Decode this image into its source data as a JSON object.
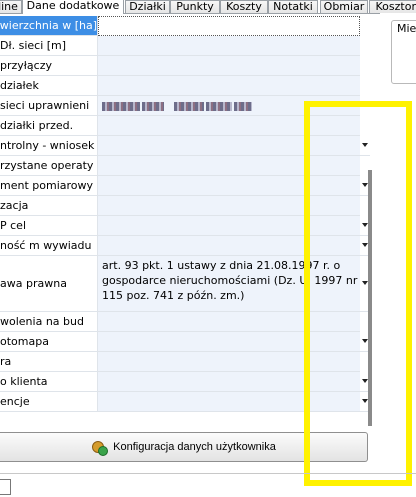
{
  "tabs": [
    {
      "label": "line"
    },
    {
      "label": "Dane dodatkowe",
      "active": true
    },
    {
      "label": "Działki"
    },
    {
      "label": "Punkty"
    },
    {
      "label": "Koszty"
    },
    {
      "label": "Notatki"
    },
    {
      "label": "Obmiar"
    },
    {
      "label": "Kosztory"
    }
  ],
  "right_panel": {
    "label": "Mie"
  },
  "properties": [
    {
      "label": "Powierzchnia w [ha]",
      "value": "",
      "selected": true
    },
    {
      "label": "Dł. sieci [m]",
      "value": ""
    },
    {
      "label": "przyłączy",
      "value": ""
    },
    {
      "label": "działek",
      "value": ""
    },
    {
      "label": "sieci uprawnieni",
      "value": "",
      "blurred": true
    },
    {
      "label": "działki przed.",
      "value": ""
    },
    {
      "label": "ntrolny - wniosek",
      "value": "",
      "dropdown": true
    },
    {
      "label": "rzystane operaty",
      "value": ""
    },
    {
      "label": "ment pomiarowy",
      "value": "",
      "dropdown": true
    },
    {
      "label": "zacja",
      "value": ""
    },
    {
      "label": "P cel",
      "value": "",
      "dropdown": true
    },
    {
      "label": "ność m wywiadu",
      "value": "",
      "dropdown": true
    },
    {
      "label": "awa prawna",
      "value": "art. 93 pkt. 1 ustawy z dnia 21.08.1997 r. o gospodarce nieruchomościami (Dz. U. 1997 nr 115 poz. 741 z późn. zm.)",
      "dropdown": true,
      "multiline": true
    },
    {
      "label": "wolenia na bud",
      "value": ""
    },
    {
      "label": "otomapa",
      "value": "",
      "dropdown": true
    },
    {
      "label": "ra",
      "value": ""
    },
    {
      "label": "o klienta",
      "value": "",
      "dropdown": true
    },
    {
      "label": "encje",
      "value": "",
      "dropdown": true
    }
  ],
  "config_button": {
    "label": "Konfiguracja danych użytkownika",
    "icon": "users-config-icon"
  },
  "colors": {
    "selected_row": "#3d8ee5",
    "value_bg": "#eef3fb",
    "highlight": "#fff200"
  }
}
